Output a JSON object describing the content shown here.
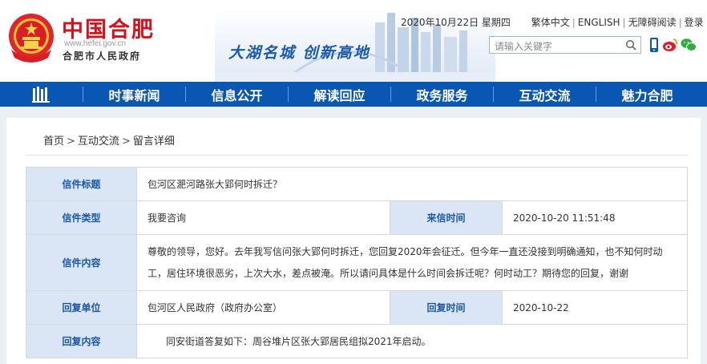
{
  "header": {
    "logo_cn": "中国合肥",
    "logo_url": "www.hefei.gov.cn",
    "logo_sub": "合肥市人民政府",
    "slogan": "大湖名城  创新高地",
    "date": "2020年10月22日 星期四",
    "links": [
      "繁体中文",
      "ENGLISH",
      "无障碍阅读",
      "登录"
    ],
    "search_placeholder": "请输入关键字"
  },
  "nav": {
    "items": [
      "时事新闻",
      "信息公开",
      "解读回应",
      "政务服务",
      "互动交流",
      "魅力合肥"
    ]
  },
  "breadcrumb": [
    "首页",
    "互动交流",
    "留言详细"
  ],
  "letter": {
    "title_label": "信件标题",
    "title_value": "包河区淝河路张大郢何时拆迁？",
    "type_label": "信件类型",
    "type_value": "我要咨询",
    "time_label": "来信时间",
    "time_value": "2020-10-20 11:51:48",
    "content_label": "信件内容",
    "content_value": "尊敬的领导，您好。去年我写信问张大郢何时拆迁，您回复2020年会征迁。但今年一直还没接到明确通知，也不知何时动工，居住环境很恶劣，上次大水，差点被淹。所以请问具体是什么时间会拆迁呢？何时动工？期待您的回复，谢谢",
    "reply_unit_label": "回复单位",
    "reply_unit_value": "包河区人民政府（政府办公室）",
    "reply_time_label": "回复时间",
    "reply_time_value": "2020-10-22",
    "reply_content_label": "回复内容",
    "reply_content_value": "同安街道答复如下：周谷堆片区张大郢居民组拟2021年启动。"
  },
  "colors": {
    "brand_red": "#d5121b",
    "nav_blue": "#0a57b3",
    "label_bg": "#dae6f5",
    "label_text": "#1b57a8"
  }
}
